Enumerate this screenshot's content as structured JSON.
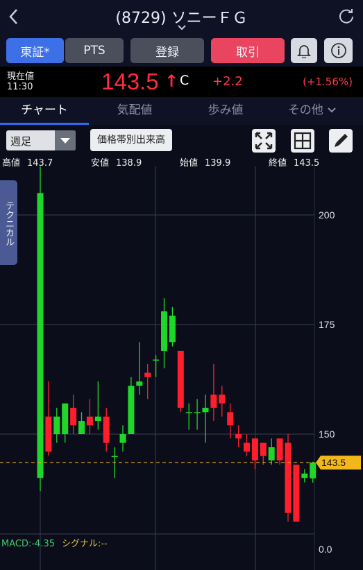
{
  "header": {
    "title": "(8729) ソニーＦＧ",
    "back_icon": "chevron-left-icon",
    "refresh_icon": "refresh-icon"
  },
  "buttons": {
    "tse": "東証*",
    "pts": "PTS",
    "register": "登録",
    "trade": "取引",
    "bell_icon": "bell-icon",
    "info_icon": "info-icon"
  },
  "quote": {
    "label": "現在値",
    "time": "11:30",
    "price": "143.5",
    "arrow": "↑",
    "flag": "C",
    "change": "+2.2",
    "change_pct": "(+1.56%)",
    "up_color": "#ff2b3c"
  },
  "tabs": [
    {
      "label": "チャート",
      "active": true
    },
    {
      "label": "気配値",
      "active": false
    },
    {
      "label": "歩み値",
      "active": false
    },
    {
      "label": "その他",
      "active": false
    }
  ],
  "controls": {
    "period": "週足",
    "volume_by_price": "価格帯別出来高",
    "expand_icon": "expand-icon",
    "grid_icon": "grid-icon",
    "pencil_icon": "pencil-icon"
  },
  "ohlc": {
    "high_label": "高値",
    "high": "143.7",
    "low_label": "安値",
    "low": "138.9",
    "open_label": "始値",
    "open": "139.9",
    "close_label": "終値",
    "close": "143.5"
  },
  "technical_tab": "テクニカル",
  "macd": {
    "macd_label": "MACD:-4.35",
    "signal_label": "シグナル:--"
  },
  "chart_data": {
    "type": "candlestick",
    "y_ticks": [
      "200",
      "175",
      "150"
    ],
    "y_range": [
      118,
      212
    ],
    "current_price": 143.5,
    "current_price_label": "143.5",
    "subpanel_tick": "0.0",
    "up_color": "#1fd629",
    "down_color": "#ff1f2c",
    "candles": [
      {
        "o": 140,
        "h": 213,
        "l": 137,
        "c": 205
      },
      {
        "o": 154,
        "h": 162,
        "l": 145,
        "c": 146
      },
      {
        "o": 150,
        "h": 156,
        "l": 148,
        "c": 154
      },
      {
        "o": 150,
        "h": 157,
        "l": 148,
        "c": 157
      },
      {
        "o": 156,
        "h": 159,
        "l": 150,
        "c": 152
      },
      {
        "o": 150,
        "h": 155,
        "l": 150,
        "c": 153
      },
      {
        "o": 154,
        "h": 158,
        "l": 150,
        "c": 152
      },
      {
        "o": 153,
        "h": 162,
        "l": 151,
        "c": 154
      },
      {
        "o": 154,
        "h": 156,
        "l": 146,
        "c": 148
      },
      {
        "o": 145,
        "h": 147,
        "l": 140,
        "c": 145
      },
      {
        "o": 148,
        "h": 152,
        "l": 146,
        "c": 150
      },
      {
        "o": 150,
        "h": 163,
        "l": 150,
        "c": 161
      },
      {
        "o": 161,
        "h": 171,
        "l": 159,
        "c": 162
      },
      {
        "o": 164,
        "h": 166,
        "l": 158,
        "c": 163
      },
      {
        "o": 167,
        "h": 168,
        "l": 163,
        "c": 167
      },
      {
        "o": 169,
        "h": 181,
        "l": 165,
        "c": 178
      },
      {
        "o": 171,
        "h": 179,
        "l": 170,
        "c": 177
      },
      {
        "o": 169,
        "h": 169,
        "l": 155,
        "c": 156
      },
      {
        "o": 155,
        "h": 157,
        "l": 151,
        "c": 155
      },
      {
        "o": 155,
        "h": 158,
        "l": 151,
        "c": 155
      },
      {
        "o": 155,
        "h": 159,
        "l": 148,
        "c": 156
      },
      {
        "o": 159,
        "h": 166,
        "l": 153,
        "c": 156
      },
      {
        "o": 159,
        "h": 161,
        "l": 154,
        "c": 157
      },
      {
        "o": 155,
        "h": 157,
        "l": 149,
        "c": 152
      },
      {
        "o": 150,
        "h": 152,
        "l": 147,
        "c": 149
      },
      {
        "o": 148,
        "h": 150,
        "l": 145,
        "c": 146
      },
      {
        "o": 149,
        "h": 149,
        "l": 142,
        "c": 144
      },
      {
        "o": 148,
        "h": 148,
        "l": 143,
        "c": 145
      },
      {
        "o": 144,
        "h": 149,
        "l": 143,
        "c": 147
      },
      {
        "o": 149,
        "h": 149,
        "l": 143,
        "c": 144
      },
      {
        "o": 148,
        "h": 150,
        "l": 130,
        "c": 132
      },
      {
        "o": 143,
        "h": 143,
        "l": 130,
        "c": 130
      },
      {
        "o": 140,
        "h": 142,
        "l": 139,
        "c": 141
      },
      {
        "o": 139.9,
        "h": 143.7,
        "l": 138.9,
        "c": 143.5
      }
    ]
  }
}
